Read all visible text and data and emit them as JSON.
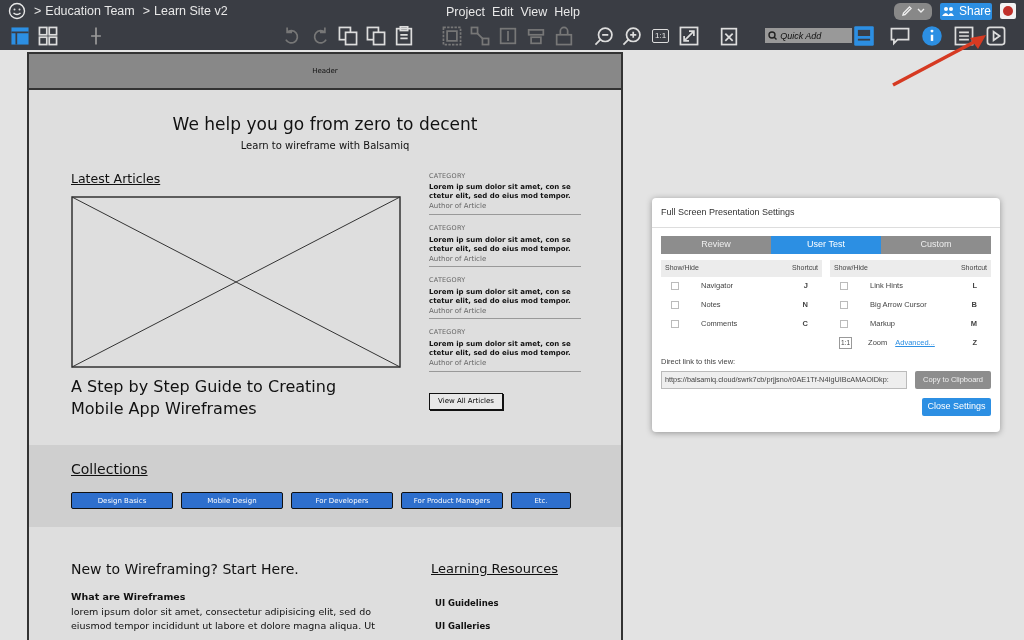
{
  "app_bar": {
    "breadcrumb": [
      {
        "separator": ">",
        "label": "Education Team"
      },
      {
        "separator": ">",
        "label": "Learn Site v2"
      }
    ],
    "menu": [
      "Project",
      "Edit",
      "View",
      "Help"
    ],
    "share_button": "Share",
    "zoom_actual": "1:1",
    "quick_add": {
      "placeholder": "Quick Add"
    }
  },
  "wireframe": {
    "header": "Header",
    "headline": "We help you go from zero to decent",
    "subhead": "Learn to wireframe with Balsamiq",
    "latest_title": "Latest Articles",
    "feature_title": "A Step by Step Guide to Creating Mobile App Wireframes",
    "articles": [
      {
        "category": "CATEGORY",
        "title": "Lorem ip sum dolor sit amet, con se ctetur elit, sed do eius mod tempor.",
        "author": "Author of Article"
      },
      {
        "category": "CATEGORY",
        "title": "Lorem ip sum dolor sit amet, con se ctetur elit, sed do eius mod tempor.",
        "author": "Author of Article"
      },
      {
        "category": "CATEGORY",
        "title": "Lorem ip sum dolor sit amet, con se ctetur elit, sed do eius mod tempor.",
        "author": "Author of Article"
      },
      {
        "category": "CATEGORY",
        "title": "Lorem ip sum dolor sit amet, con se ctetur elit, sed do eius mod tempor.",
        "author": "Author of Article"
      }
    ],
    "view_all": "View All Articles",
    "collections_title": "Collections",
    "collections": [
      "Design Basics",
      "Mobile Design",
      "For Developers",
      "For Product Managers",
      "Etc."
    ],
    "intro_title": "New to Wireframing? Start Here.",
    "intro_subtitle": "What are Wireframes",
    "intro_lines": [
      "lorem ipsum dolor sit amet, consectetur adipisicing elit, sed do",
      "eiusmod tempor incididunt ut labore et dolore magna aliqua. Ut"
    ],
    "resources_title": "Learning Resources",
    "resources": [
      "UI Guidelines",
      "UI Galleries"
    ]
  },
  "dialog": {
    "title": "Full Screen Presentation Settings",
    "modes": [
      {
        "label": "Review",
        "selected": false
      },
      {
        "label": "User Test",
        "selected": true
      },
      {
        "label": "Custom",
        "selected": false
      }
    ],
    "left_headers": [
      "Show/Hide",
      "Shortcut"
    ],
    "right_headers": [
      "Show/Hide",
      "Shortcut"
    ],
    "left_options": [
      {
        "label": "Navigator",
        "shortcut": "J",
        "checked": false
      },
      {
        "label": "Notes",
        "shortcut": "N",
        "checked": false
      },
      {
        "label": "Comments",
        "shortcut": "C",
        "checked": false
      }
    ],
    "right_options": [
      {
        "kind": "checkbox",
        "label": "Link Hints",
        "shortcut": "L",
        "checked": false
      },
      {
        "kind": "checkbox",
        "label": "Big Arrow Cursor",
        "shortcut": "B",
        "checked": false
      },
      {
        "kind": "checkbox",
        "label": "Markup",
        "shortcut": "M",
        "checked": false
      },
      {
        "kind": "zoom",
        "value": "1:1",
        "label": "Zoom",
        "link": "Advanced...",
        "shortcut": "Z"
      }
    ],
    "link_label": "Direct link to this view:",
    "link_value": "https://balsamiq.cloud/swrk7cb/prjjsno/r0AE1Tf-N4IgUIBcAMAOIDkp:",
    "copy_button": "Copy to Clipboard",
    "close_button": "Close Settings"
  }
}
